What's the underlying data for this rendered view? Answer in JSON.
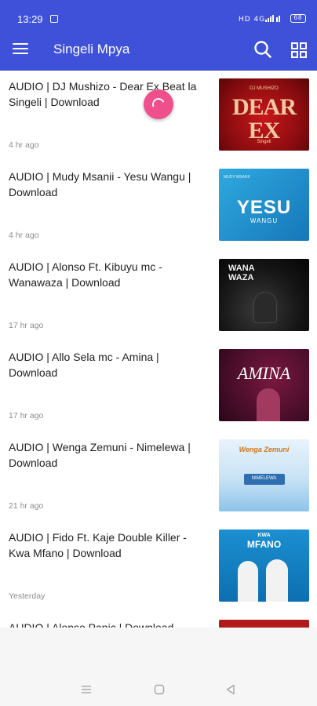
{
  "status_bar": {
    "time": "13:29",
    "signal_text": "ℕᴴ ⁴ᴳ↑↑ ⁴ᴳ",
    "battery": "68"
  },
  "app_bar": {
    "title": "Singeli Mpya",
    "menu_icon": "hamburger-menu-icon",
    "search_icon": "search-icon",
    "grid_icon": "grid-view-icon",
    "color": "#3f51d8"
  },
  "posts": [
    {
      "title": "AUDIO | DJ Mushizo - Dear Ex Beat la Singeli | Download",
      "time": "4 hr ago",
      "thumb": {
        "top": "DJ MUSHIZO",
        "main": "DEAR EX",
        "bottom": "Singeli"
      }
    },
    {
      "title": "AUDIO | Mudy Msanii - Yesu Wangu | Download",
      "time": "4 hr ago",
      "thumb": {
        "top": "MUDY MSANII",
        "main": "YESU",
        "bottom": "WANGU"
      }
    },
    {
      "title": "AUDIO | Alonso Ft. Kibuyu mc - Wanawaza | Download",
      "time": "17 hr ago",
      "thumb": {
        "top": "WANA",
        "main": "WAZA",
        "bottom": ""
      }
    },
    {
      "title": "AUDIO | Allo Sela mc - Amina | Download",
      "time": "17 hr ago",
      "thumb": {
        "top": "",
        "main": "AMINA",
        "bottom": ""
      }
    },
    {
      "title": "AUDIO | Wenga Zemuni - Nimelewa | Download",
      "time": "21 hr ago",
      "thumb": {
        "top": "Wenga Zemuni",
        "main": "NIMELEWA",
        "bottom": ""
      }
    },
    {
      "title": "AUDIO | Fido Ft. Kaje Double Killer - Kwa Mfano | Download",
      "time": "Yesterday",
      "thumb": {
        "top": "KWA",
        "main": "MFANO",
        "bottom": ""
      }
    },
    {
      "title": "AUDIO | Alonso Panic | Download",
      "time": "",
      "thumb": {
        "top": "",
        "main": "",
        "bottom": ""
      }
    }
  ],
  "nav_bar": {
    "recents_icon": "recents-icon",
    "home_icon": "home-icon",
    "back_icon": "back-icon"
  }
}
